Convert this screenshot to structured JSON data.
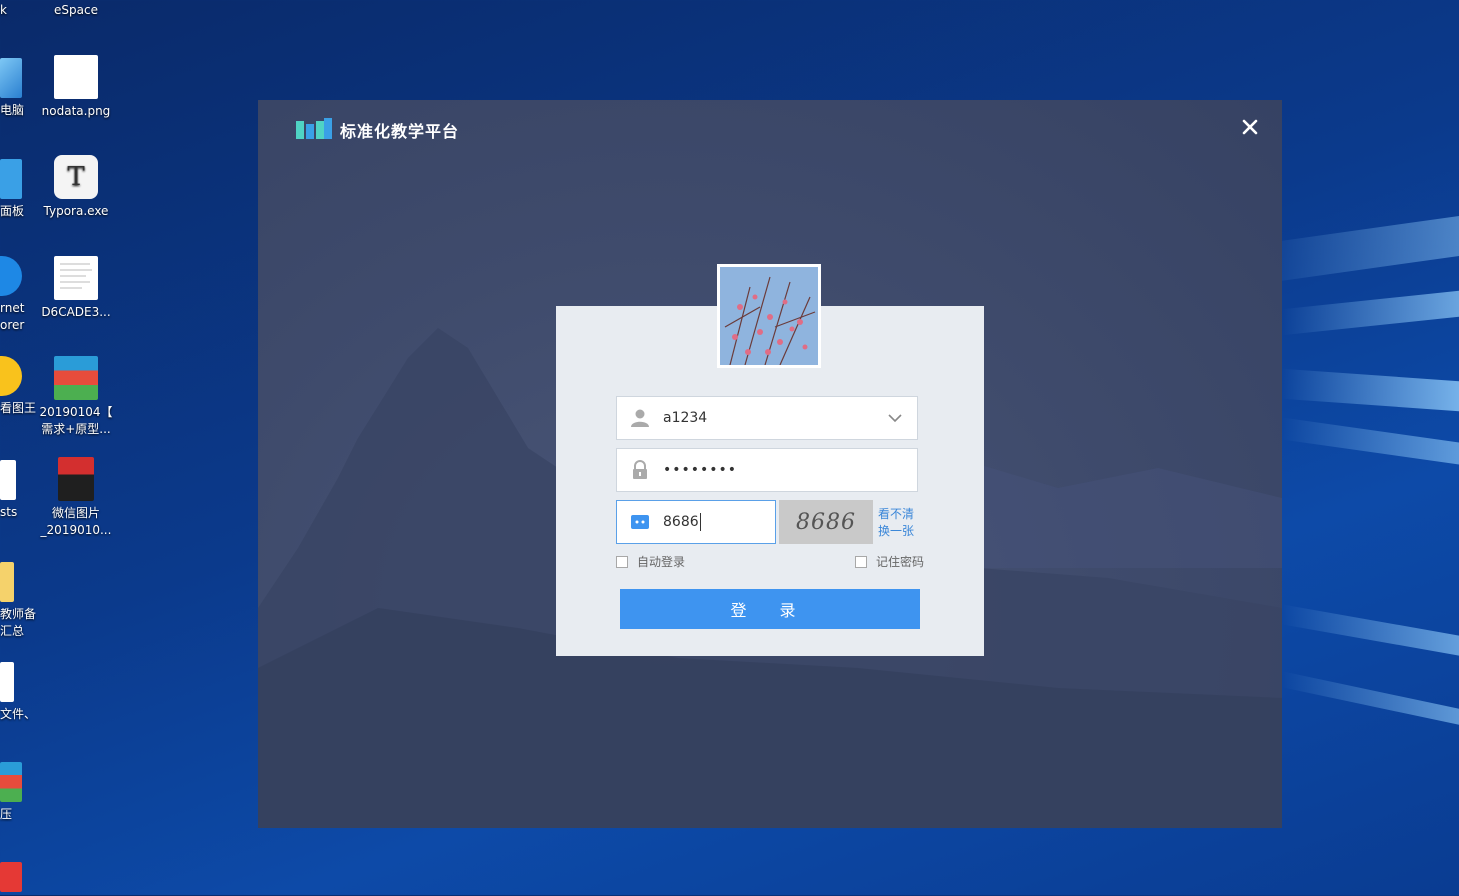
{
  "desktop": {
    "icons": [
      {
        "label": "eSpace",
        "icon": "espace-icon"
      },
      {
        "label": "nodata.png",
        "icon": "image-file-icon"
      },
      {
        "label": "Typora.exe",
        "icon": "typora-icon"
      },
      {
        "label": "D6CADE3...",
        "icon": "document-file-icon"
      },
      {
        "label": "20190104【\n需求+原型...",
        "icon": "archive-icon"
      },
      {
        "label": "微信图片\n_2019010...",
        "icon": "photo-file-icon"
      }
    ],
    "partial_icons": [
      {
        "label": "k"
      },
      {
        "label": "电脑"
      },
      {
        "label": "面板"
      },
      {
        "label": "rnet\norer"
      },
      {
        "label": "看图王"
      },
      {
        "label": "sts"
      },
      {
        "label": "教师备\n汇总"
      },
      {
        "label": "文件、"
      },
      {
        "label": "压"
      }
    ]
  },
  "dialog": {
    "app_title": "标准化教学平台",
    "username": {
      "value": "a1234"
    },
    "password": {
      "value": "••••••••"
    },
    "captcha": {
      "input_value": "8686",
      "image_text": "8686",
      "refresh_line1": "看不清",
      "refresh_line2": "换一张"
    },
    "auto_login_label": "自动登录",
    "remember_password_label": "记住密码",
    "login_button": "登 录"
  },
  "colors": {
    "accent": "#3e94f0",
    "link": "#3a86d8",
    "panel_bg": "#e8ecf1",
    "dialog_bg": "#3f4b6c"
  }
}
